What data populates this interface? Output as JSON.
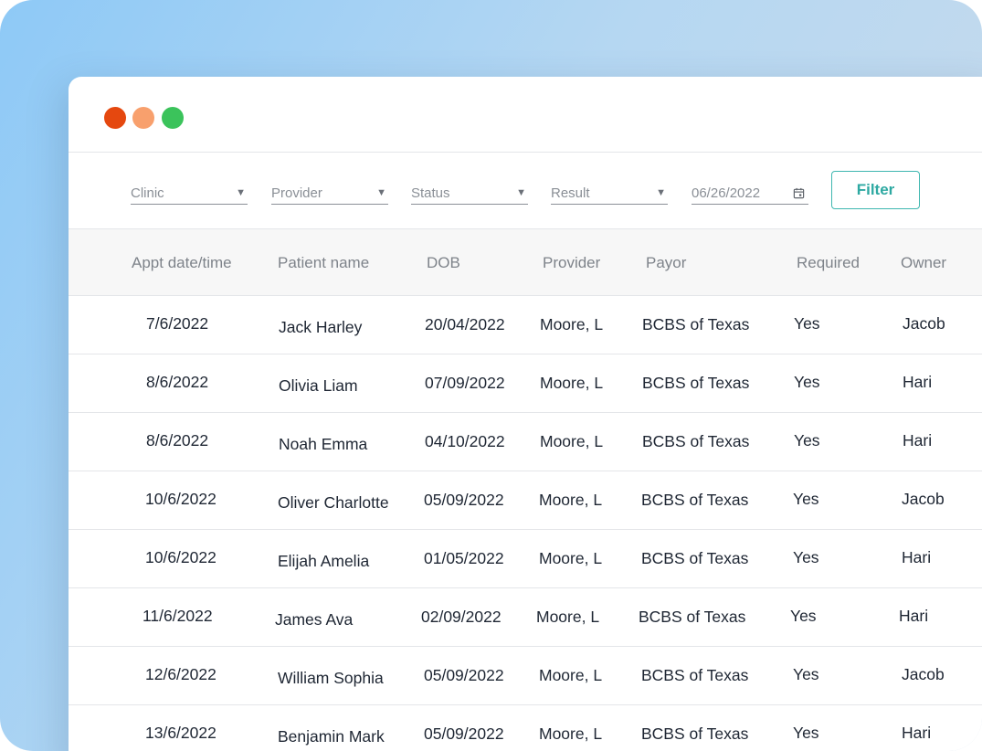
{
  "filters": {
    "clinic_placeholder": "Clinic",
    "provider_placeholder": "Provider",
    "status_placeholder": "Status",
    "result_placeholder": "Result",
    "date_value": "06/26/2022",
    "filter_button_label": "Filter"
  },
  "table": {
    "columns": [
      "Appt date/time",
      "Patient name",
      "DOB",
      "Provider",
      "Payor",
      "Required",
      "Owner"
    ],
    "rows": [
      [
        "7/6/2022",
        "Jack Harley",
        "20/04/2022",
        "Moore, L",
        "BCBS of Texas",
        "Yes",
        "Jacob"
      ],
      [
        "8/6/2022",
        "Olivia Liam",
        "07/09/2022",
        "Moore, L",
        "BCBS of Texas",
        "Yes",
        "Hari"
      ],
      [
        "8/6/2022",
        "Noah Emma",
        "04/10/2022",
        "Moore, L",
        "BCBS of Texas",
        "Yes",
        "Hari"
      ],
      [
        "10/6/2022",
        "Oliver Charlotte",
        "05/09/2022",
        "Moore, L",
        "BCBS of Texas",
        "Yes",
        "Jacob"
      ],
      [
        "10/6/2022",
        "Elijah Amelia",
        "01/05/2022",
        "Moore, L",
        "BCBS of Texas",
        "Yes",
        "Hari"
      ],
      [
        "11/6/2022",
        "James Ava",
        "02/09/2022",
        "Moore, L",
        "BCBS of Texas",
        "Yes",
        "Hari"
      ],
      [
        "12/6/2022",
        "William Sophia",
        "05/09/2022",
        "Moore, L",
        "BCBS of Texas",
        "Yes",
        "Jacob"
      ],
      [
        "13/6/2022",
        "Benjamin Mark",
        "05/09/2022",
        "Moore, L",
        "BCBS of Texas",
        "Yes",
        "Hari"
      ]
    ]
  },
  "colors": {
    "accent": "#3fb7b0",
    "window_close": "#e5480f",
    "window_minimize": "#f8a06d",
    "window_maximize": "#3bc35b"
  }
}
